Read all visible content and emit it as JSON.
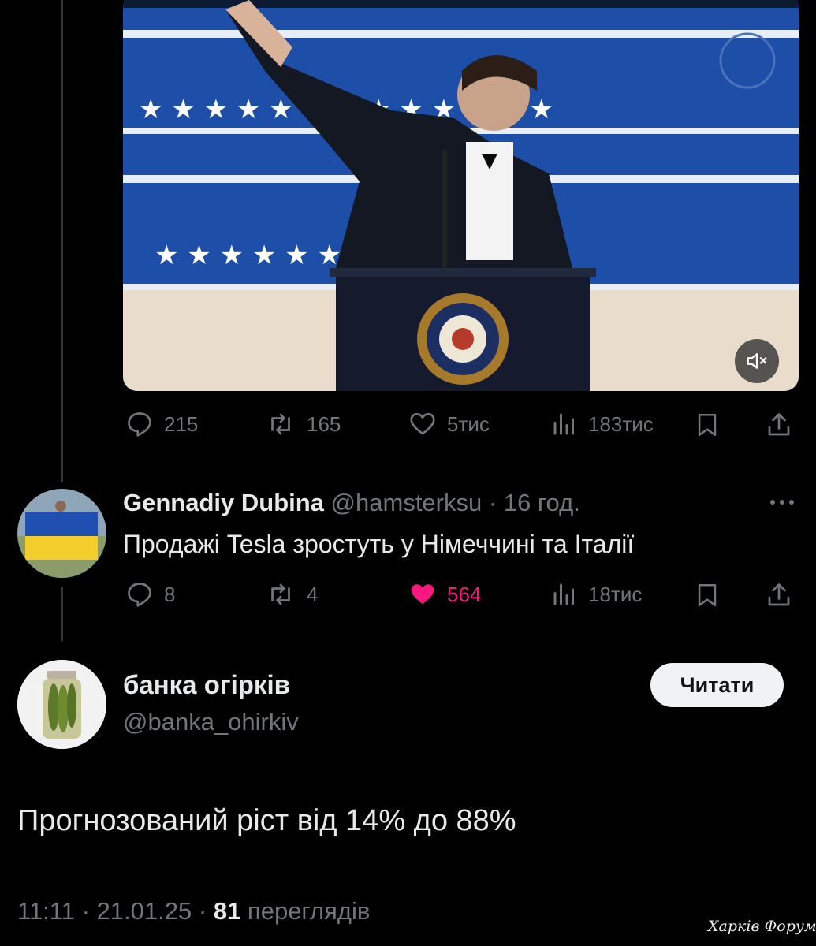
{
  "video": {
    "mute_icon": "volume-muted-icon"
  },
  "tweet1_actions": {
    "replies": "215",
    "retweets": "165",
    "likes": "5тис",
    "views": "183тис"
  },
  "reply": {
    "display_name": "Gennadiy Dubina",
    "handle": "@hamsterksu",
    "separator": "·",
    "time": "16 год.",
    "text": "Продажі Tesla зростуть у Німеччині та Італії",
    "replies": "8",
    "retweets": "4",
    "likes": "564",
    "views": "18тис",
    "like_color": "#f91880"
  },
  "main_tweet": {
    "display_name": "банка огірків",
    "handle": "@banka_ohirkiv",
    "follow_label": "Читати",
    "text": "Прогнозований ріст від 14% до 88%",
    "time": "11:11",
    "date": "21.01.25",
    "sep1": "·",
    "sep2": "·",
    "views_count": "81",
    "views_label": "переглядів"
  },
  "watermark": "Харків Форум"
}
